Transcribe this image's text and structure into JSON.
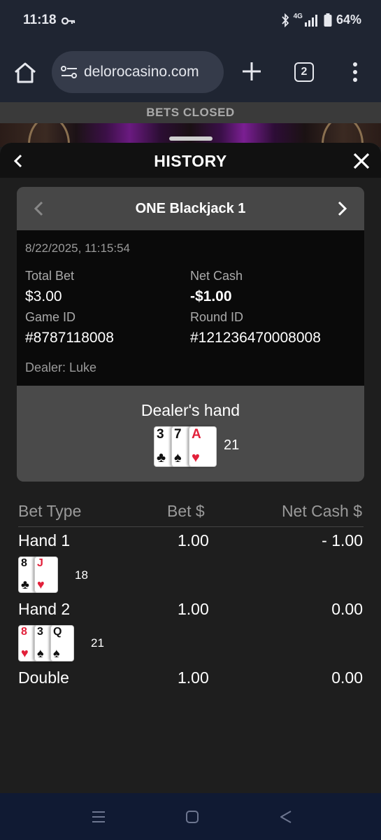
{
  "status": {
    "time": "11:18",
    "network": "4G",
    "battery": "64%"
  },
  "browser": {
    "url": "delorocasino.com",
    "tab_count": "2"
  },
  "casino": {
    "banner": "BETS CLOSED"
  },
  "history": {
    "title": "HISTORY",
    "game_name": "ONE Blackjack 1",
    "datetime": "8/22/2025, 11:15:54",
    "total_bet_label": "Total Bet",
    "total_bet": "$3.00",
    "net_cash_label": "Net Cash",
    "net_cash": "-$1.00",
    "game_id_label": "Game ID",
    "game_id": "#8787118008",
    "round_id_label": "Round ID",
    "round_id": "#121236470008008",
    "dealer": "Dealer: Luke",
    "dealer_hand_title": "Dealer's hand",
    "dealer_cards": [
      {
        "rank": "3",
        "suit": "♣",
        "color": "black"
      },
      {
        "rank": "7",
        "suit": "♠",
        "color": "black"
      },
      {
        "rank": "A",
        "suit": "♥",
        "color": "red"
      }
    ],
    "dealer_total": "21"
  },
  "bets": {
    "columns": [
      "Bet Type",
      "Bet $",
      "Net Cash $"
    ],
    "rows": [
      {
        "type": "Hand 1",
        "bet": "1.00",
        "net": "- 1.00",
        "cards": [
          {
            "rank": "8",
            "suit": "♣",
            "color": "black"
          },
          {
            "rank": "J",
            "suit": "♥",
            "color": "red"
          }
        ],
        "total": "18"
      },
      {
        "type": "Hand 2",
        "bet": "1.00",
        "net": "0.00",
        "cards": [
          {
            "rank": "8",
            "suit": "♥",
            "color": "red"
          },
          {
            "rank": "3",
            "suit": "♠",
            "color": "black"
          },
          {
            "rank": "Q",
            "suit": "♠",
            "color": "black"
          }
        ],
        "total": "21"
      },
      {
        "type": "Double",
        "bet": "1.00",
        "net": "0.00"
      }
    ]
  },
  "colors": {
    "panel_bg": "#1e1e1e",
    "card_bg": "#4a4a4a",
    "details_bg": "#0a0a0a",
    "red_suit": "#e2203a",
    "nav_bar": "#101a33"
  }
}
